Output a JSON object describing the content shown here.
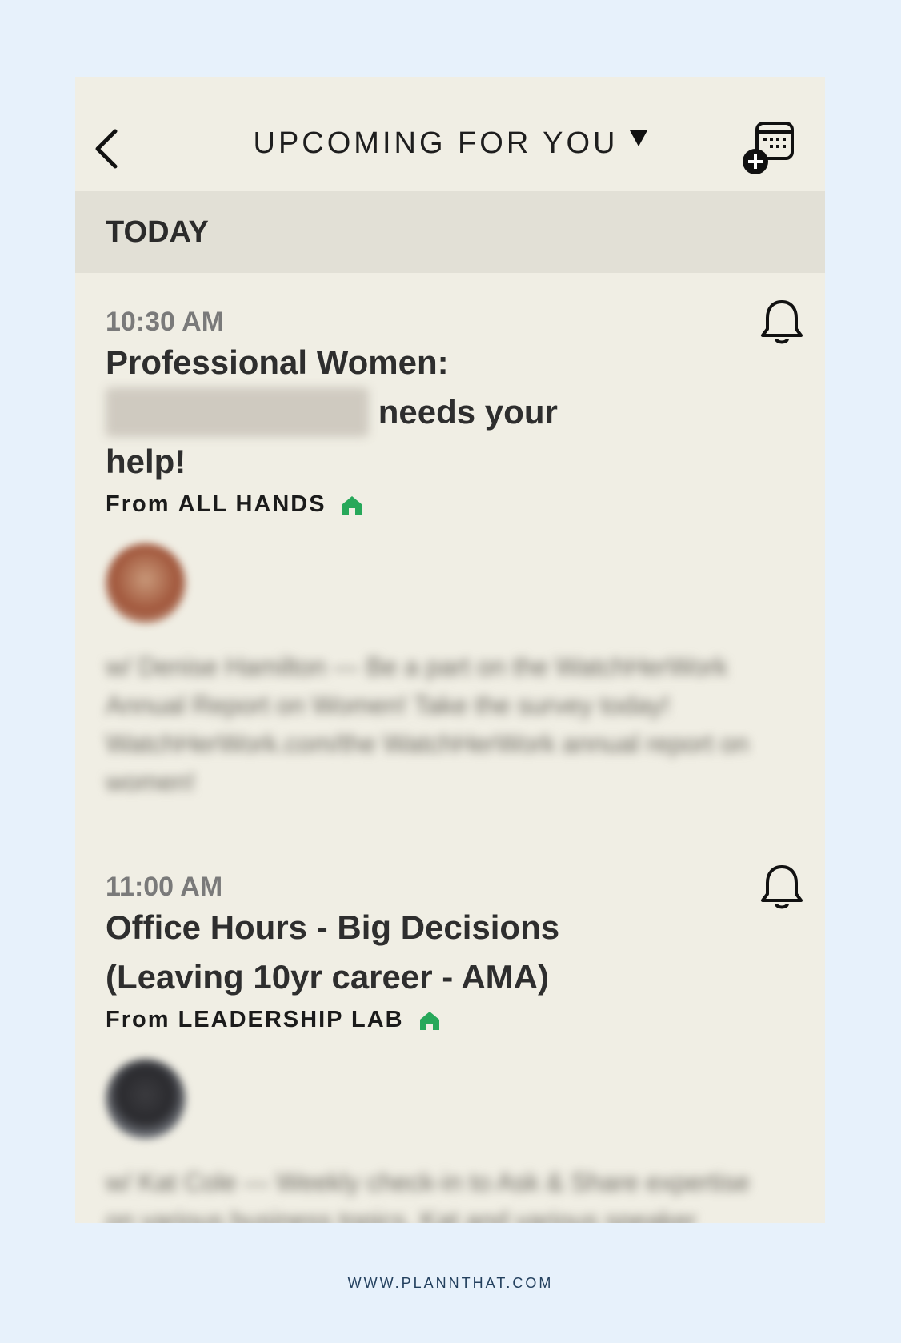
{
  "header": {
    "title": "UPCOMING FOR YOU",
    "back_icon": "chevron-left-icon",
    "calendar_icon": "calendar-add-icon"
  },
  "section": {
    "label": "TODAY"
  },
  "events": [
    {
      "time": "10:30 AM",
      "title_prefix": "Professional Women:",
      "title_suffix": "needs your help!",
      "from_prefix": "From",
      "group": "ALL HANDS",
      "description": "w/ Denise Hamilton — Be a part on the WatchHerWork Annual Report on Women! Take the survey today! WatchHerWork.com/the WatchHerWork annual report on women!"
    },
    {
      "time": "11:00 AM",
      "title": "Office Hours - Big Decisions (Leaving 10yr career - AMA)",
      "from_prefix": "From",
      "group": "LEADERSHIP LAB",
      "description": "w/ Kat Cole — Weekly check-in to Ask & Share expertise on various business topics. Kat and various speaker guests answer and ask questions on branding..."
    }
  ],
  "footer": {
    "text": "WWW.PLANNTHAT.COM"
  },
  "colors": {
    "background": "#e7f1fb",
    "card": "#f0eee4",
    "section": "#e2e0d6",
    "home_green": "#27a85a"
  }
}
